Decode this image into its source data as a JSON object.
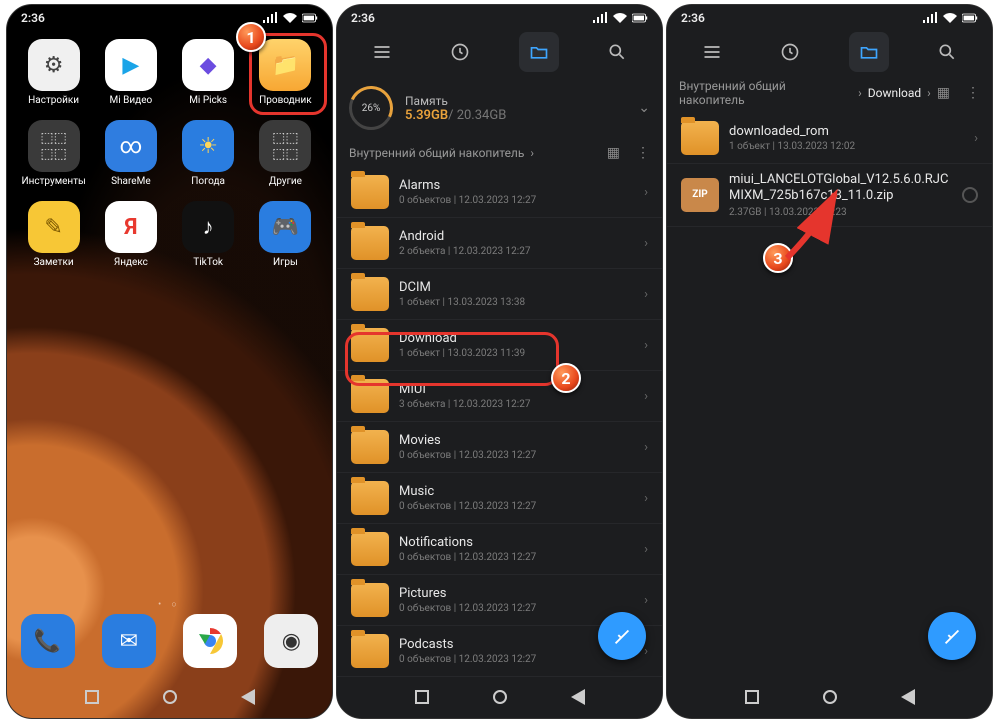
{
  "status": {
    "time": "2:36"
  },
  "home": {
    "apps_row1": [
      {
        "label": "Настройки",
        "name": "settings",
        "bg": "#f0f0f0",
        "glyph": "⚙",
        "gc": "#444"
      },
      {
        "label": "Mi Видео",
        "name": "mi-video",
        "bg": "#ffffff",
        "glyph": "▶",
        "gc": "#1aa4e8"
      },
      {
        "label": "Mi Picks",
        "name": "mi-picks",
        "bg": "#ffffff",
        "glyph": "◆",
        "gc": "#6b4ce0"
      },
      {
        "label": "Проводник",
        "name": "file-manager",
        "bg": "#f7b733",
        "glyph": "📁",
        "gc": "#fff"
      }
    ],
    "apps_row2": [
      {
        "label": "Инструменты",
        "name": "tools-folder",
        "bg": "#3b3b3b",
        "glyph": "▦",
        "gc": "#ddd"
      },
      {
        "label": "ShareMe",
        "name": "shareme",
        "bg": "#2f7de0",
        "glyph": "∞",
        "gc": "#fff"
      },
      {
        "label": "Погода",
        "name": "weather",
        "bg": "#2a7de0",
        "glyph": "☀",
        "gc": "#ffd65a"
      },
      {
        "label": "Другие",
        "name": "more-folder",
        "bg": "#3b3b3b",
        "glyph": "▦",
        "gc": "#ddd"
      }
    ],
    "apps_row3": [
      {
        "label": "Заметки",
        "name": "notes",
        "bg": "#f7c736",
        "glyph": "✎",
        "gc": "#6a4b00"
      },
      {
        "label": "Яндекс",
        "name": "yandex",
        "bg": "#ffffff",
        "glyph": "Я",
        "gc": "#e8392f"
      },
      {
        "label": "TikTok",
        "name": "tiktok",
        "bg": "#111111",
        "glyph": "♪",
        "gc": "#fff"
      },
      {
        "label": "Игры",
        "name": "games",
        "bg": "#2a7de0",
        "glyph": "🎮",
        "gc": "#fff"
      }
    ],
    "dock": [
      {
        "name": "phone",
        "bg": "#2a7de0",
        "glyph": "📞",
        "gc": "#fff"
      },
      {
        "name": "messages",
        "bg": "#2a7de0",
        "glyph": "✉",
        "gc": "#fff"
      },
      {
        "name": "chrome",
        "bg": "#ffffff",
        "glyph": "◯",
        "gc": "#e8392f"
      },
      {
        "name": "camera",
        "bg": "#eeeeee",
        "glyph": "◉",
        "gc": "#333"
      }
    ]
  },
  "fm2": {
    "mem": {
      "label": "Память",
      "pct": "26%",
      "used": "5.39GB",
      "total": "20.34GB"
    },
    "bc_root": "Внутренний общий накопитель",
    "folders": [
      {
        "name": "Alarms",
        "sub": "0 объектов | 12.03.2023 12:27"
      },
      {
        "name": "Android",
        "sub": "2 объекта | 12.03.2023 12:27"
      },
      {
        "name": "DCIM",
        "sub": "1 объект | 13.03.2023 13:38"
      },
      {
        "name": "Download",
        "sub": "1 объект | 13.03.2023 11:39"
      },
      {
        "name": "MIUI",
        "sub": "3 объекта | 12.03.2023 12:27"
      },
      {
        "name": "Movies",
        "sub": "0 объектов | 12.03.2023 12:27"
      },
      {
        "name": "Music",
        "sub": "0 объектов | 12.03.2023 12:27"
      },
      {
        "name": "Notifications",
        "sub": "0 объектов | 12.03.2023 12:27"
      },
      {
        "name": "Pictures",
        "sub": "0 объектов | 12.03.2023 12:27"
      },
      {
        "name": "Podcasts",
        "sub": "0 объектов | 12.03.2023 12:27"
      }
    ]
  },
  "fm3": {
    "bc_root": "Внутренний общий накопитель",
    "bc_child": "Download",
    "items": [
      {
        "type": "folder",
        "name": "downloaded_rom",
        "sub": "1 объект | 13.03.2023 12:02"
      },
      {
        "type": "zip",
        "name": "miui_LANCELOTGlobal_V12.5.6.0.RJCMIXM_725b167c13_11.0.zip",
        "sub": "2.37GB | 13.03.2023 21:23",
        "badge": "ZIP"
      }
    ]
  },
  "badges": {
    "b1": "1",
    "b2": "2",
    "b3": "3"
  }
}
